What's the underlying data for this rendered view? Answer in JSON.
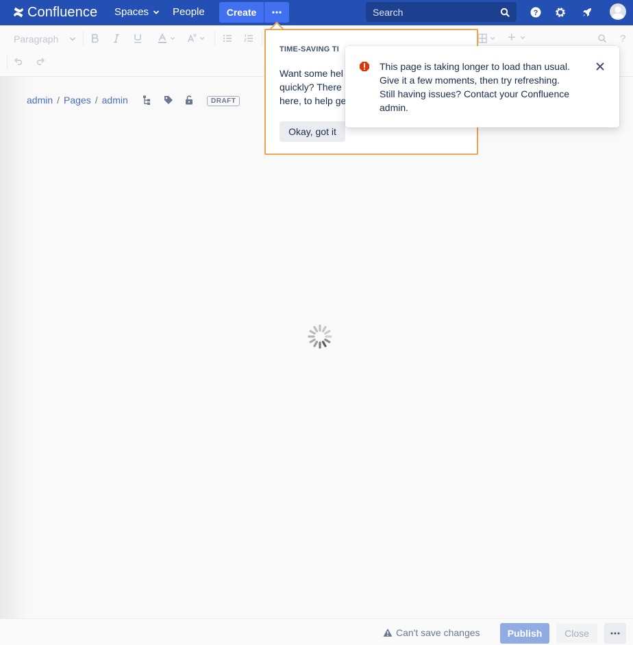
{
  "header": {
    "logo_text": "Confluence",
    "nav": [
      {
        "label": "Spaces",
        "has_dropdown": true
      },
      {
        "label": "People",
        "has_dropdown": false
      }
    ],
    "create_label": "Create",
    "more_icon": "ellipsis-icon",
    "search_placeholder": "Search",
    "icons": [
      "help-icon",
      "settings-icon",
      "notifications-rocket-icon",
      "avatar"
    ],
    "bg_color": "#244fb3"
  },
  "toolbar": {
    "paragraph_label": "Paragraph",
    "buttons": [
      "bold",
      "italic",
      "underline",
      "text-color",
      "text-style",
      "bullet-list",
      "numbered-list",
      "table",
      "insert",
      "find",
      "help",
      "undo",
      "redo"
    ],
    "insert_symbol": "+"
  },
  "breadcrumb": {
    "items": [
      "admin",
      "Pages",
      "admin"
    ],
    "separator": "/",
    "draft_badge": "DRAFT"
  },
  "tips": {
    "title": "TIME-SAVING TI",
    "body_line1": "Want some hel",
    "body_line2": "quickly? There",
    "body_line3": "here, to help ge",
    "button_label": "Okay, got it",
    "border_color": "#f0a24e"
  },
  "flag": {
    "icon": "error-icon",
    "line1": "This page is taking longer to load than usual.",
    "line2": "Give it a few moments, then try refreshing.",
    "line3": "Still having issues? Contact your Confluence",
    "line4": "admin.",
    "close_icon": "close-icon",
    "icon_color": "#de350b"
  },
  "footer": {
    "status": "Can't save changes",
    "publish_label": "Publish",
    "close_label": "Close",
    "more_icon": "ellipsis-icon"
  }
}
